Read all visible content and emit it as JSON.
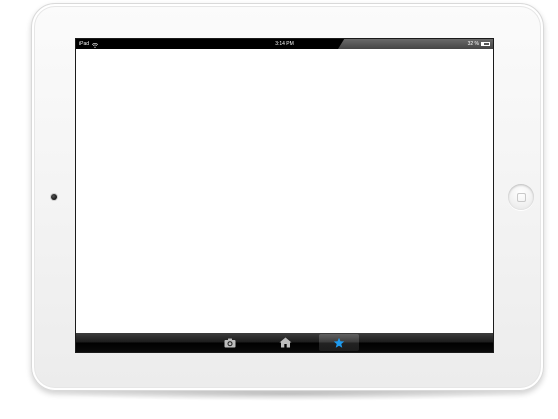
{
  "device": {
    "model": "iPad",
    "frame_color": "#f3f3f3"
  },
  "status_bar": {
    "carrier": "iPad",
    "wifi_icon": "wifi-icon",
    "time": "3:14 PM",
    "battery_percent_text": "32 %",
    "battery_level": 0.32,
    "battery_icon": "battery-icon"
  },
  "tab_bar": {
    "items": [
      {
        "icon": "camera-icon",
        "selected": false,
        "color": "#bdbdbd"
      },
      {
        "icon": "home-icon",
        "selected": false,
        "color": "#bdbdbd"
      },
      {
        "icon": "star-icon",
        "selected": true,
        "color": "#1e9bf0"
      }
    ]
  }
}
